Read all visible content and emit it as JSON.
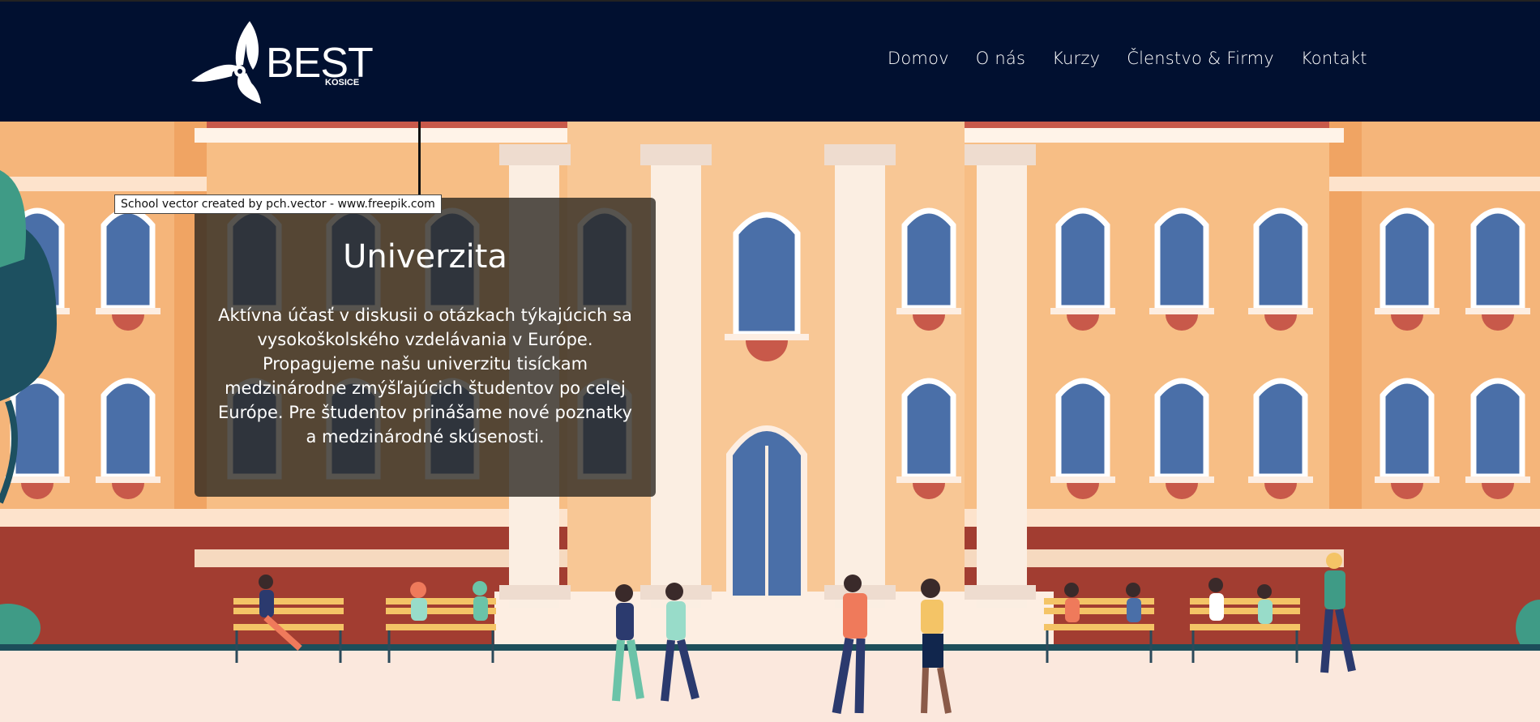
{
  "header": {
    "logo": {
      "name": "BEST",
      "subtitle": "KOSICE"
    },
    "nav": [
      {
        "label": "Domov"
      },
      {
        "label": "O nás"
      },
      {
        "label": "Kurzy"
      },
      {
        "label": "Členstvo & Firmy"
      },
      {
        "label": "Kontakt"
      }
    ]
  },
  "hero": {
    "credit": "School vector created by pch.vector - www.freepik.com",
    "title": "Univerzita",
    "text": "Aktívna účasť v diskusii o otázkach týkajúcich sa vysokoškolského vzdelávania v Európe. Propagujeme našu univerzitu tisíckam medzinárodne zmýšľajúcich študentov po celej Európe. Pre študentov prinášame nové poznatky a medzinárodné skúsenosti."
  },
  "colors": {
    "header_bg": "#011030",
    "wall": "#f7be85",
    "wall_dark": "#f0a463",
    "column": "#fbeee2",
    "roof_red": "#a23d31",
    "window_frame": "#ffffff",
    "window_glass": "#4a6fa8",
    "ground": "#fbe8dd"
  }
}
